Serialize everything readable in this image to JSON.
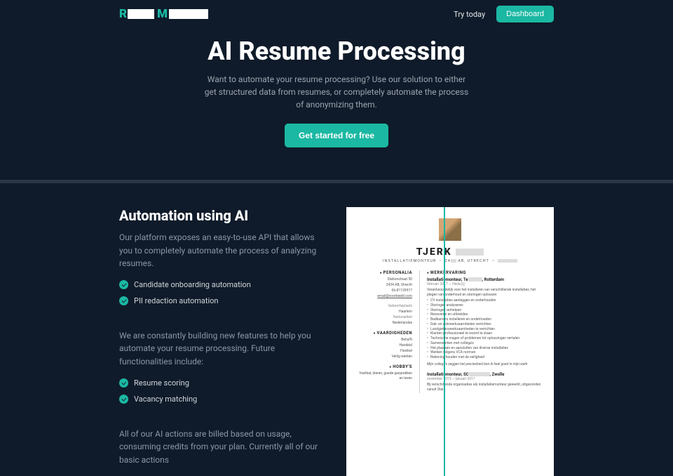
{
  "header": {
    "try_label": "Try today",
    "dashboard_label": "Dashboard"
  },
  "hero": {
    "title": "AI Resume Processing",
    "subtitle": "Want to automate your resume processing? Use our solution to either get structured data from resumes, or completely automate the process of anonymizing them.",
    "cta": "Get started for free"
  },
  "section": {
    "heading": "Automation using AI",
    "p1": "Our platform exposes an easy-to-use API that allows you to completely automate the process of analyzing resumes.",
    "features1": [
      "Candidate onboarding automation",
      "PII redaction automation"
    ],
    "p2": "We are constantly building new features to help you automate your resume processing. Future functionalities include:",
    "features2": [
      "Resume scoring",
      "Vacancy matching"
    ],
    "p3": "All of our AI actions are billed based on usage, consuming credits from your plan. Currently all of our basic actions"
  },
  "resume": {
    "name": "TJERK",
    "role_prefix": "INSTALLATIEMONTEUR",
    "role_loc": "AB, UTRECHT",
    "personalia_h": "PERSONALIA",
    "addr1": "Stationstraat 50",
    "addr2": "2434 AB, Utrecht",
    "phone": "06-81159977",
    "email": "email@voorbeeld.com",
    "geb_h": "Geboorteplaats",
    "geb_v": "Haarlem",
    "nat_h": "Nationaliteit",
    "nat_v": "Nederlandse",
    "vaard_h": "VAARDIGHEDEN",
    "skills": [
      "Behulft",
      "Handeld",
      "Flexibel",
      "Veilig werken"
    ],
    "hobby_h": "HOBBY'S",
    "hobby_v": "Voetbal, dieren, goede gesprekken en lezen",
    "werk_h": "WERKERVARING",
    "job1_t": "Installatiemonteur, Te",
    "job1_loc": ", Rotterdam",
    "job1_d": "februari 2017 — Hede",
    "job1_desc": "Verantwoordelijk voor het installeren van verschillende installaties, het plegen van onderhoud en storingen oplossen",
    "job1_bullets": [
      "CV installaties aanleggen en onderhouden",
      "Storingen analyseren",
      "Storingen verhelpen",
      "Renoveren en uitbreiden",
      "Badkamers installeren en onderhouden",
      "Dak- en zinkwerkzaamheden verrichten",
      "Loodgieterswerkzaamheden te verrichten",
      "Klanten professioneel te woord te staan",
      "Technische vragen of problemen tot oplossingen vertalen",
      "Samenwerken met collega's",
      "Het plaatsen en aansluiten van diverse installaties",
      "Werken volgens VCA normen",
      "Rekening houden met de veiligheid"
    ],
    "job1_foot": "Mijn collega's zeggen het preciesheid ben ik heel goed in mijn werk",
    "job2_t": "Installatiemonteur, SC",
    "job2_loc": ", Zwolle",
    "job2_d": "november 2015 — januari 2017",
    "job2_desc": "Bij verschillende organisaties als installatiemonteur gewerkt, uitgezonden vanuit Start."
  }
}
